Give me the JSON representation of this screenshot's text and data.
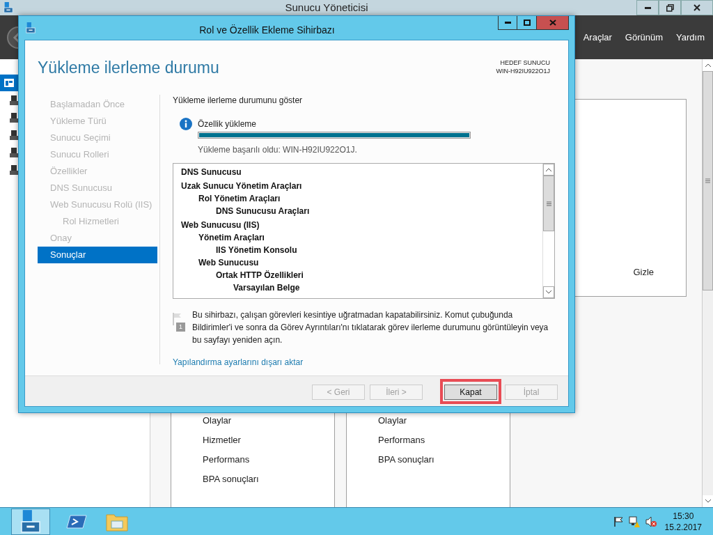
{
  "window": {
    "title": "Sunucu Yöneticisi"
  },
  "menu": [
    "Araçlar",
    "Görünüm",
    "Yardım"
  ],
  "background": {
    "hide_label": "Gizle",
    "tiles": [
      {
        "items": [
          "Olaylar",
          "Hizmetler",
          "Performans",
          "BPA sonuçları"
        ]
      },
      {
        "items": [
          "Olaylar",
          "Performans",
          "BPA sonuçları"
        ]
      }
    ]
  },
  "dialog": {
    "title": "Rol ve Özellik Ekleme Sihirbazı",
    "page_title": "Yükleme ilerleme durumu",
    "target_label": "HEDEF SUNUCU",
    "target_server": "WIN-H92IU922O1J",
    "steps": [
      {
        "label": "Başlamadan Önce",
        "selected": false
      },
      {
        "label": "Yükleme Türü",
        "selected": false
      },
      {
        "label": "Sunucu Seçimi",
        "selected": false
      },
      {
        "label": "Sunucu Rolleri",
        "selected": false
      },
      {
        "label": "Özellikler",
        "selected": false
      },
      {
        "label": "DNS Sunucusu",
        "selected": false
      },
      {
        "label": "Web Sunucusu Rolü (IIS)",
        "selected": false,
        "children": [
          {
            "label": "Rol Hizmetleri",
            "selected": false
          }
        ]
      },
      {
        "label": "Onay",
        "selected": false
      },
      {
        "label": "Sonuçlar",
        "selected": true
      }
    ],
    "section_heading": "Yükleme ilerleme durumunu göster",
    "status": {
      "label": "Özellik yükleme",
      "level": 1,
      "message": "Yükleme başarılı oldu: WIN-H92IU922O1J."
    },
    "results": [
      {
        "label": "DNS Sunucusu"
      },
      {
        "label": "Uzak Sunucu Yönetim Araçları",
        "children": [
          {
            "label": "Rol Yönetim Araçları",
            "children": [
              {
                "label": "DNS Sunucusu Araçları"
              }
            ]
          }
        ]
      },
      {
        "label": "Web Sunucusu (IIS)",
        "children": [
          {
            "label": "Yönetim Araçları",
            "children": [
              {
                "label": "IIS Yönetim Konsolu"
              }
            ]
          },
          {
            "label": "Web Sunucusu",
            "children": [
              {
                "label": "Ortak HTTP Özellikleri",
                "children": [
                  {
                    "label": "Varsayılan Belge"
                  }
                ]
              }
            ]
          }
        ]
      }
    ],
    "note_badge": "1",
    "note": "Bu sihirbazı, çalışan görevleri kesintiye uğratmadan kapatabilirsiniz. Komut çubuğunda Bildirimler'i ve sonra da Görev Ayrıntıları'nı tıklatarak görev ilerleme durumunu görüntüleyin veya bu sayfayı yeniden açın.",
    "export_link": "Yapılandırma ayarlarını dışarı aktar",
    "buttons": [
      {
        "label": "< Geri",
        "disabled": true,
        "highlighted": false
      },
      {
        "label": "İleri >",
        "disabled": true,
        "highlighted": false
      },
      {
        "label": "Kapat",
        "disabled": false,
        "highlighted": true
      },
      {
        "label": "İptal",
        "disabled": true,
        "highlighted": false
      }
    ]
  },
  "taskbar": {
    "time": "15:30",
    "date": "15.2.2017"
  }
}
